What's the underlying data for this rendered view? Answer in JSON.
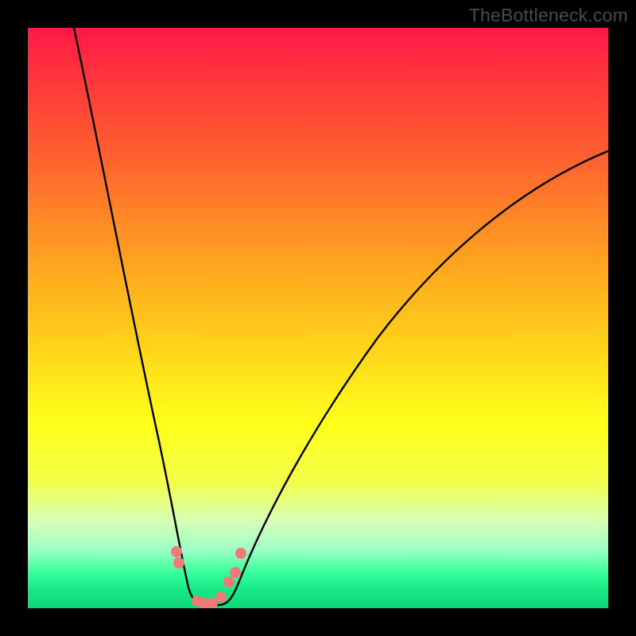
{
  "watermark": "TheBottleneck.com",
  "chart_data": {
    "type": "line",
    "title": "",
    "xlabel": "",
    "ylabel": "",
    "xlim": [
      0,
      1
    ],
    "ylim": [
      0,
      1
    ],
    "background_gradient": {
      "top_color": "#ff1846",
      "mid_color": "#ffff1a",
      "bottom_color": "#0fd87a",
      "meaning": "red=high bottleneck, green=low bottleneck"
    },
    "series": [
      {
        "name": "bottleneck-curve",
        "stroke": "#000000",
        "x": [
          0.08,
          0.12,
          0.16,
          0.2,
          0.24,
          0.26,
          0.28,
          0.295,
          0.31,
          0.335,
          0.36,
          0.4,
          0.46,
          0.54,
          0.64,
          0.76,
          0.88,
          1.0
        ],
        "values": [
          1.0,
          0.78,
          0.56,
          0.36,
          0.17,
          0.09,
          0.03,
          0.005,
          0.005,
          0.03,
          0.08,
          0.16,
          0.27,
          0.4,
          0.52,
          0.63,
          0.72,
          0.79
        ]
      },
      {
        "name": "markers",
        "type": "scatter",
        "color": "#ef7a78",
        "x": [
          0.255,
          0.26,
          0.29,
          0.3,
          0.315,
          0.33,
          0.345,
          0.355,
          0.365
        ],
        "values": [
          0.095,
          0.075,
          0.01,
          0.006,
          0.006,
          0.02,
          0.045,
          0.06,
          0.095
        ]
      }
    ]
  }
}
